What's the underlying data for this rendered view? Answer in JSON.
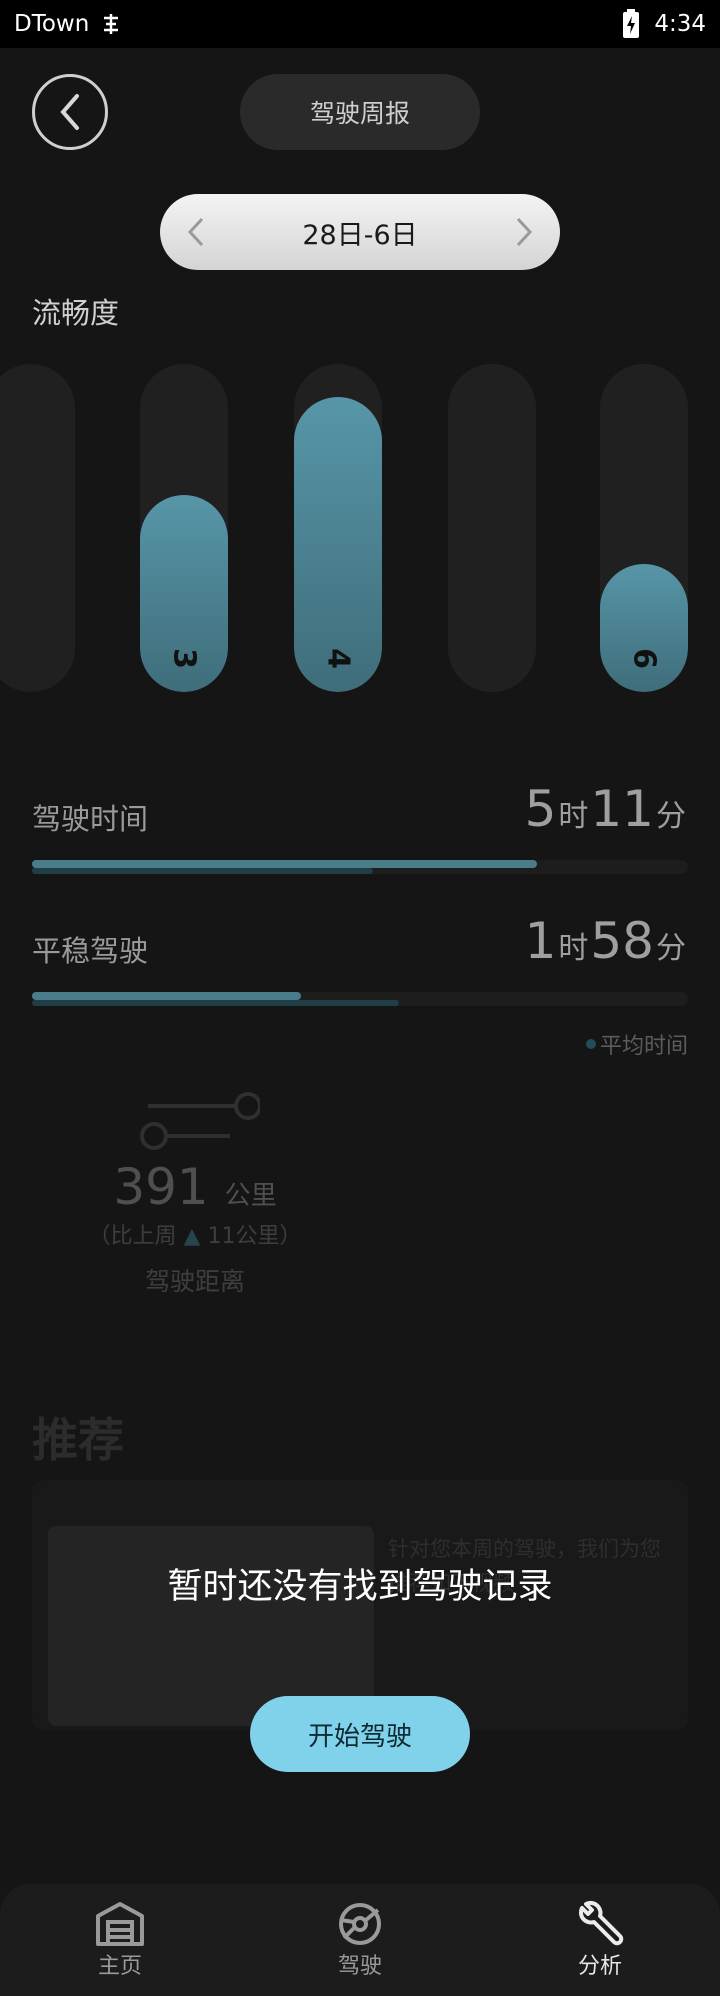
{
  "status_bar": {
    "carrier": "DTown",
    "time": "4:34"
  },
  "header": {
    "title": "驾驶周报",
    "date_range": "28日-6日"
  },
  "fluency": {
    "label": "流畅度",
    "bars": [
      {
        "label": "",
        "level": 0
      },
      {
        "label": "3",
        "level": 0.6
      },
      {
        "label": "4",
        "level": 0.9
      },
      {
        "label": "",
        "level": 0
      },
      {
        "label": "6",
        "level": 0.39
      }
    ]
  },
  "metrics": {
    "drive_time": {
      "title": "驾驶时间",
      "hours": "5",
      "hour_unit": "时",
      "minutes": "11",
      "minute_unit": "分",
      "progress": 0.77,
      "average": 0.52
    },
    "smooth_drive": {
      "title": "平稳驾驶",
      "hours": "1",
      "hour_unit": "时",
      "minutes": "58",
      "minute_unit": "分",
      "progress": 0.41,
      "average": 0.56
    }
  },
  "legend": {
    "average_label": "平均时间"
  },
  "distance": {
    "value": "391",
    "unit": "公里",
    "compare_prefix": "（比上周",
    "compare_triangle": "▲",
    "compare_value": "11公里）",
    "label": "驾驶距离"
  },
  "recommend": {
    "title": "推荐",
    "text": "针对您本周的驾驶，我们为您推荐如下视频"
  },
  "empty_state": {
    "message": "暂时还没有找到驾驶记录",
    "start_button": "开始驾驶"
  },
  "nav": {
    "items": [
      {
        "label": "主页",
        "icon": "garage-icon"
      },
      {
        "label": "驾驶",
        "icon": "steering-wheel-icon"
      },
      {
        "label": "分析",
        "icon": "wrench-icon"
      }
    ]
  },
  "colors": {
    "bar_fill": "#5796a8",
    "accent_button": "#7fd2ea",
    "background": "#151515"
  }
}
